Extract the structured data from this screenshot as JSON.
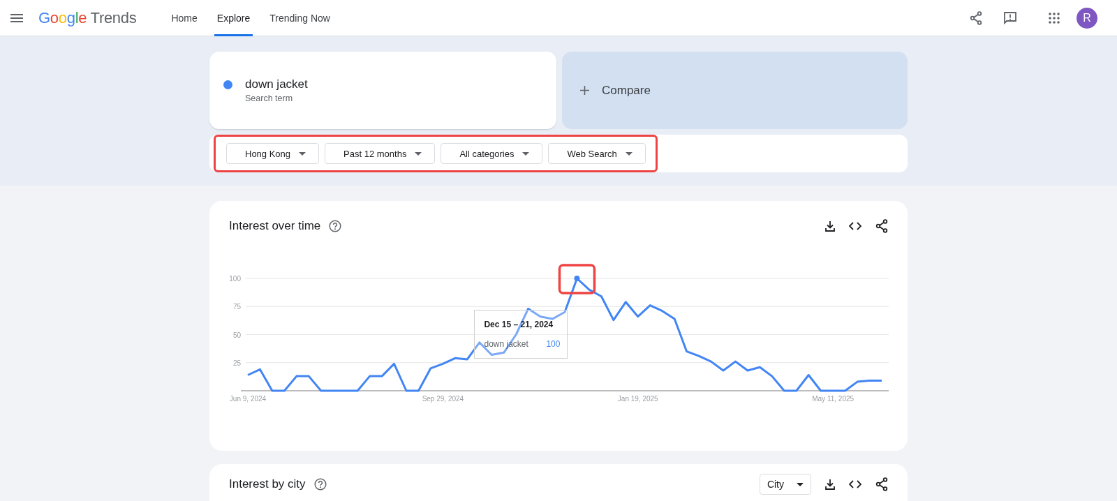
{
  "header": {
    "logo": {
      "brand": "Google",
      "product": "Trends"
    },
    "nav": [
      {
        "label": "Home",
        "selected": false
      },
      {
        "label": "Explore",
        "selected": true
      },
      {
        "label": "Trending Now",
        "selected": false
      }
    ],
    "avatar": "R"
  },
  "search": {
    "terms": [
      {
        "label": "down jacket",
        "sublabel": "Search term",
        "color": "#4285f4"
      }
    ],
    "compare": "Compare"
  },
  "filters": {
    "highlighted": true,
    "items": [
      {
        "label": "Hong Kong"
      },
      {
        "label": "Past 12 months"
      },
      {
        "label": "All categories"
      },
      {
        "label": "Web Search"
      }
    ]
  },
  "interest_over_time": {
    "title": "Interest over time",
    "tooltip": {
      "title": "Dec 15 – 21, 2024",
      "value": "100",
      "highlighted": true
    },
    "chart_data": {
      "type": "line",
      "categories": [
        "Jun 9, 2024",
        null,
        null,
        null,
        null,
        null,
        null,
        null,
        null,
        null,
        null,
        null,
        null,
        null,
        null,
        null,
        "Sep 29, 2024",
        null,
        null,
        null,
        null,
        null,
        null,
        null,
        null,
        null,
        null,
        null,
        null,
        null,
        null,
        null,
        "Jan 19, 2025",
        null,
        null,
        null,
        null,
        null,
        null,
        null,
        null,
        null,
        null,
        null,
        null,
        null,
        null,
        null,
        "May 11, 2025",
        null,
        null,
        null,
        null
      ],
      "series": [
        {
          "name": "down jacket",
          "color": "#4285f4",
          "values": [
            14,
            19,
            0,
            0,
            13,
            13,
            0,
            0,
            0,
            0,
            13,
            13,
            24,
            0,
            0,
            20,
            24,
            29,
            28,
            43,
            32,
            34,
            50,
            73,
            66,
            64,
            70,
            100,
            90,
            84,
            63,
            79,
            66,
            76,
            71,
            64,
            35,
            31,
            26,
            18,
            26,
            18,
            21,
            13,
            0,
            0,
            14,
            0,
            0,
            0,
            8,
            9,
            9
          ]
        }
      ],
      "ylim": [
        0,
        100
      ],
      "yticks": [
        25,
        50,
        75,
        100
      ],
      "grid": true
    }
  },
  "interest_by_city": {
    "title": "Interest by city",
    "dropdown": "City"
  }
}
